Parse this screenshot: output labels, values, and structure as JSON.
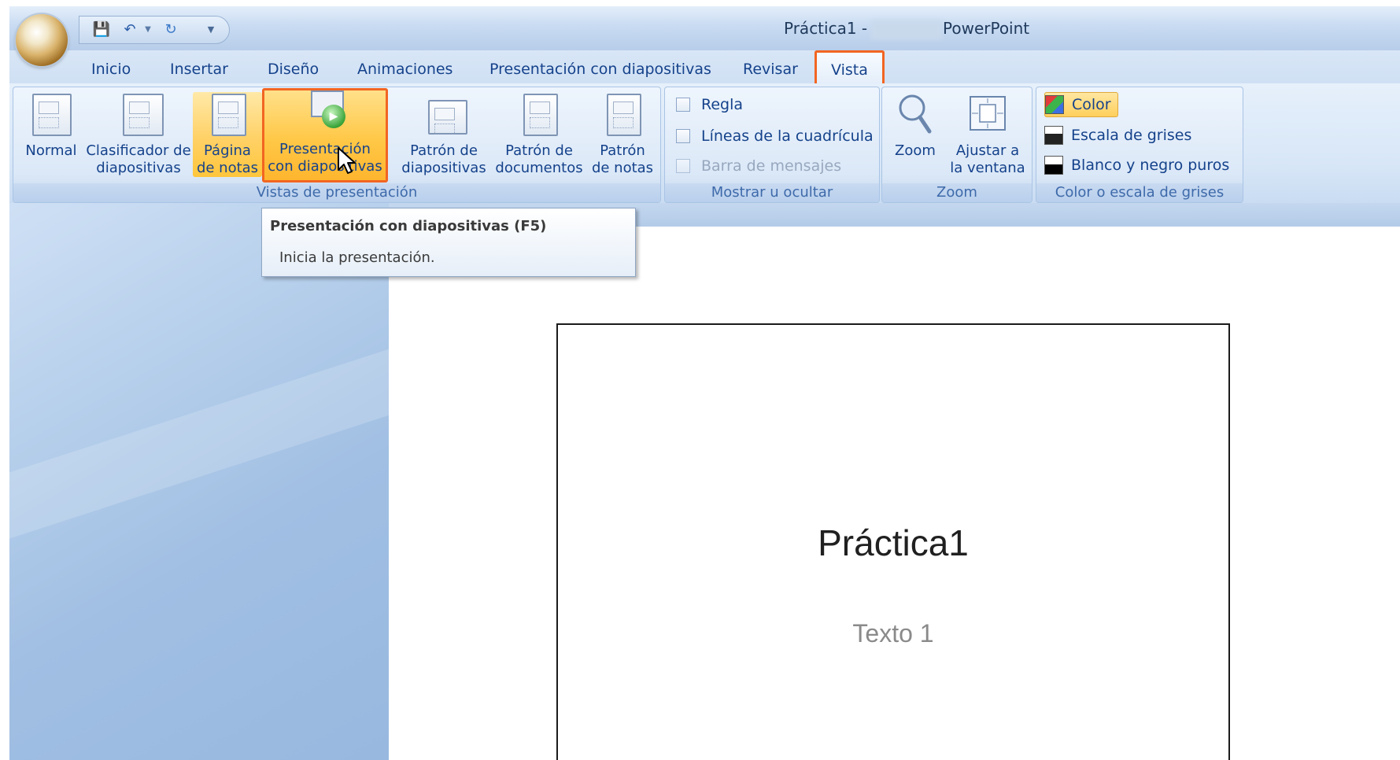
{
  "title_bar": {
    "document_title": "Práctica1 -",
    "app_name": "PowerPoint",
    "qat_icons": [
      "save-icon",
      "undo-icon",
      "redo-icon",
      "customize-qat-icon"
    ]
  },
  "tabs": [
    {
      "label": "Inicio"
    },
    {
      "label": "Insertar"
    },
    {
      "label": "Diseño"
    },
    {
      "label": "Animaciones"
    },
    {
      "label": "Presentación con diapositivas"
    },
    {
      "label": "Revisar"
    },
    {
      "label": "Vista",
      "active": true,
      "highlight_color": "#f26522"
    }
  ],
  "ribbon": {
    "vistas": {
      "label": "Vistas de presentación",
      "buttons": [
        {
          "label": "Normal",
          "icon": "normal-view-icon"
        },
        {
          "label": "Clasificador de\ndiapositivas",
          "icon": "slide-sorter-icon"
        },
        {
          "label": "Página\nde notas",
          "icon": "notes-page-icon",
          "state": "selected"
        },
        {
          "label": "Presentación\ncon diapositivas",
          "icon": "slideshow-icon",
          "state": "hover-highlighted"
        },
        {
          "label": "Patrón de\ndiapositivas",
          "icon": "slide-master-icon"
        },
        {
          "label": "Patrón de\ndocumentos",
          "icon": "handout-master-icon"
        },
        {
          "label": "Patrón\nde notas",
          "icon": "notes-master-icon"
        }
      ]
    },
    "mostrar": {
      "label": "Mostrar u ocultar",
      "items": [
        {
          "label": "Regla",
          "checked": false,
          "enabled": true
        },
        {
          "label": "Líneas de la cuadrícula",
          "checked": false,
          "enabled": true
        },
        {
          "label": "Barra de mensajes",
          "checked": false,
          "enabled": false
        }
      ]
    },
    "zoom": {
      "label": "Zoom",
      "buttons": [
        {
          "label": "Zoom",
          "icon": "magnifier-icon"
        },
        {
          "label": "Ajustar a\nla ventana",
          "icon": "fit-window-icon"
        }
      ]
    },
    "color": {
      "label": "Color o escala de grises",
      "items": [
        {
          "label": "Color",
          "state": "selected"
        },
        {
          "label": "Escala de grises"
        },
        {
          "label": "Blanco y negro puros"
        }
      ]
    }
  },
  "tooltip": {
    "title": "Presentación con diapositivas (F5)",
    "description": "Inicia la presentación."
  },
  "slide": {
    "title": "Práctica1",
    "subtitle": "Texto 1"
  },
  "colors": {
    "accent_highlight": "#f26522",
    "ribbon_text": "#15428b",
    "hover_fill": "#ffc847"
  }
}
